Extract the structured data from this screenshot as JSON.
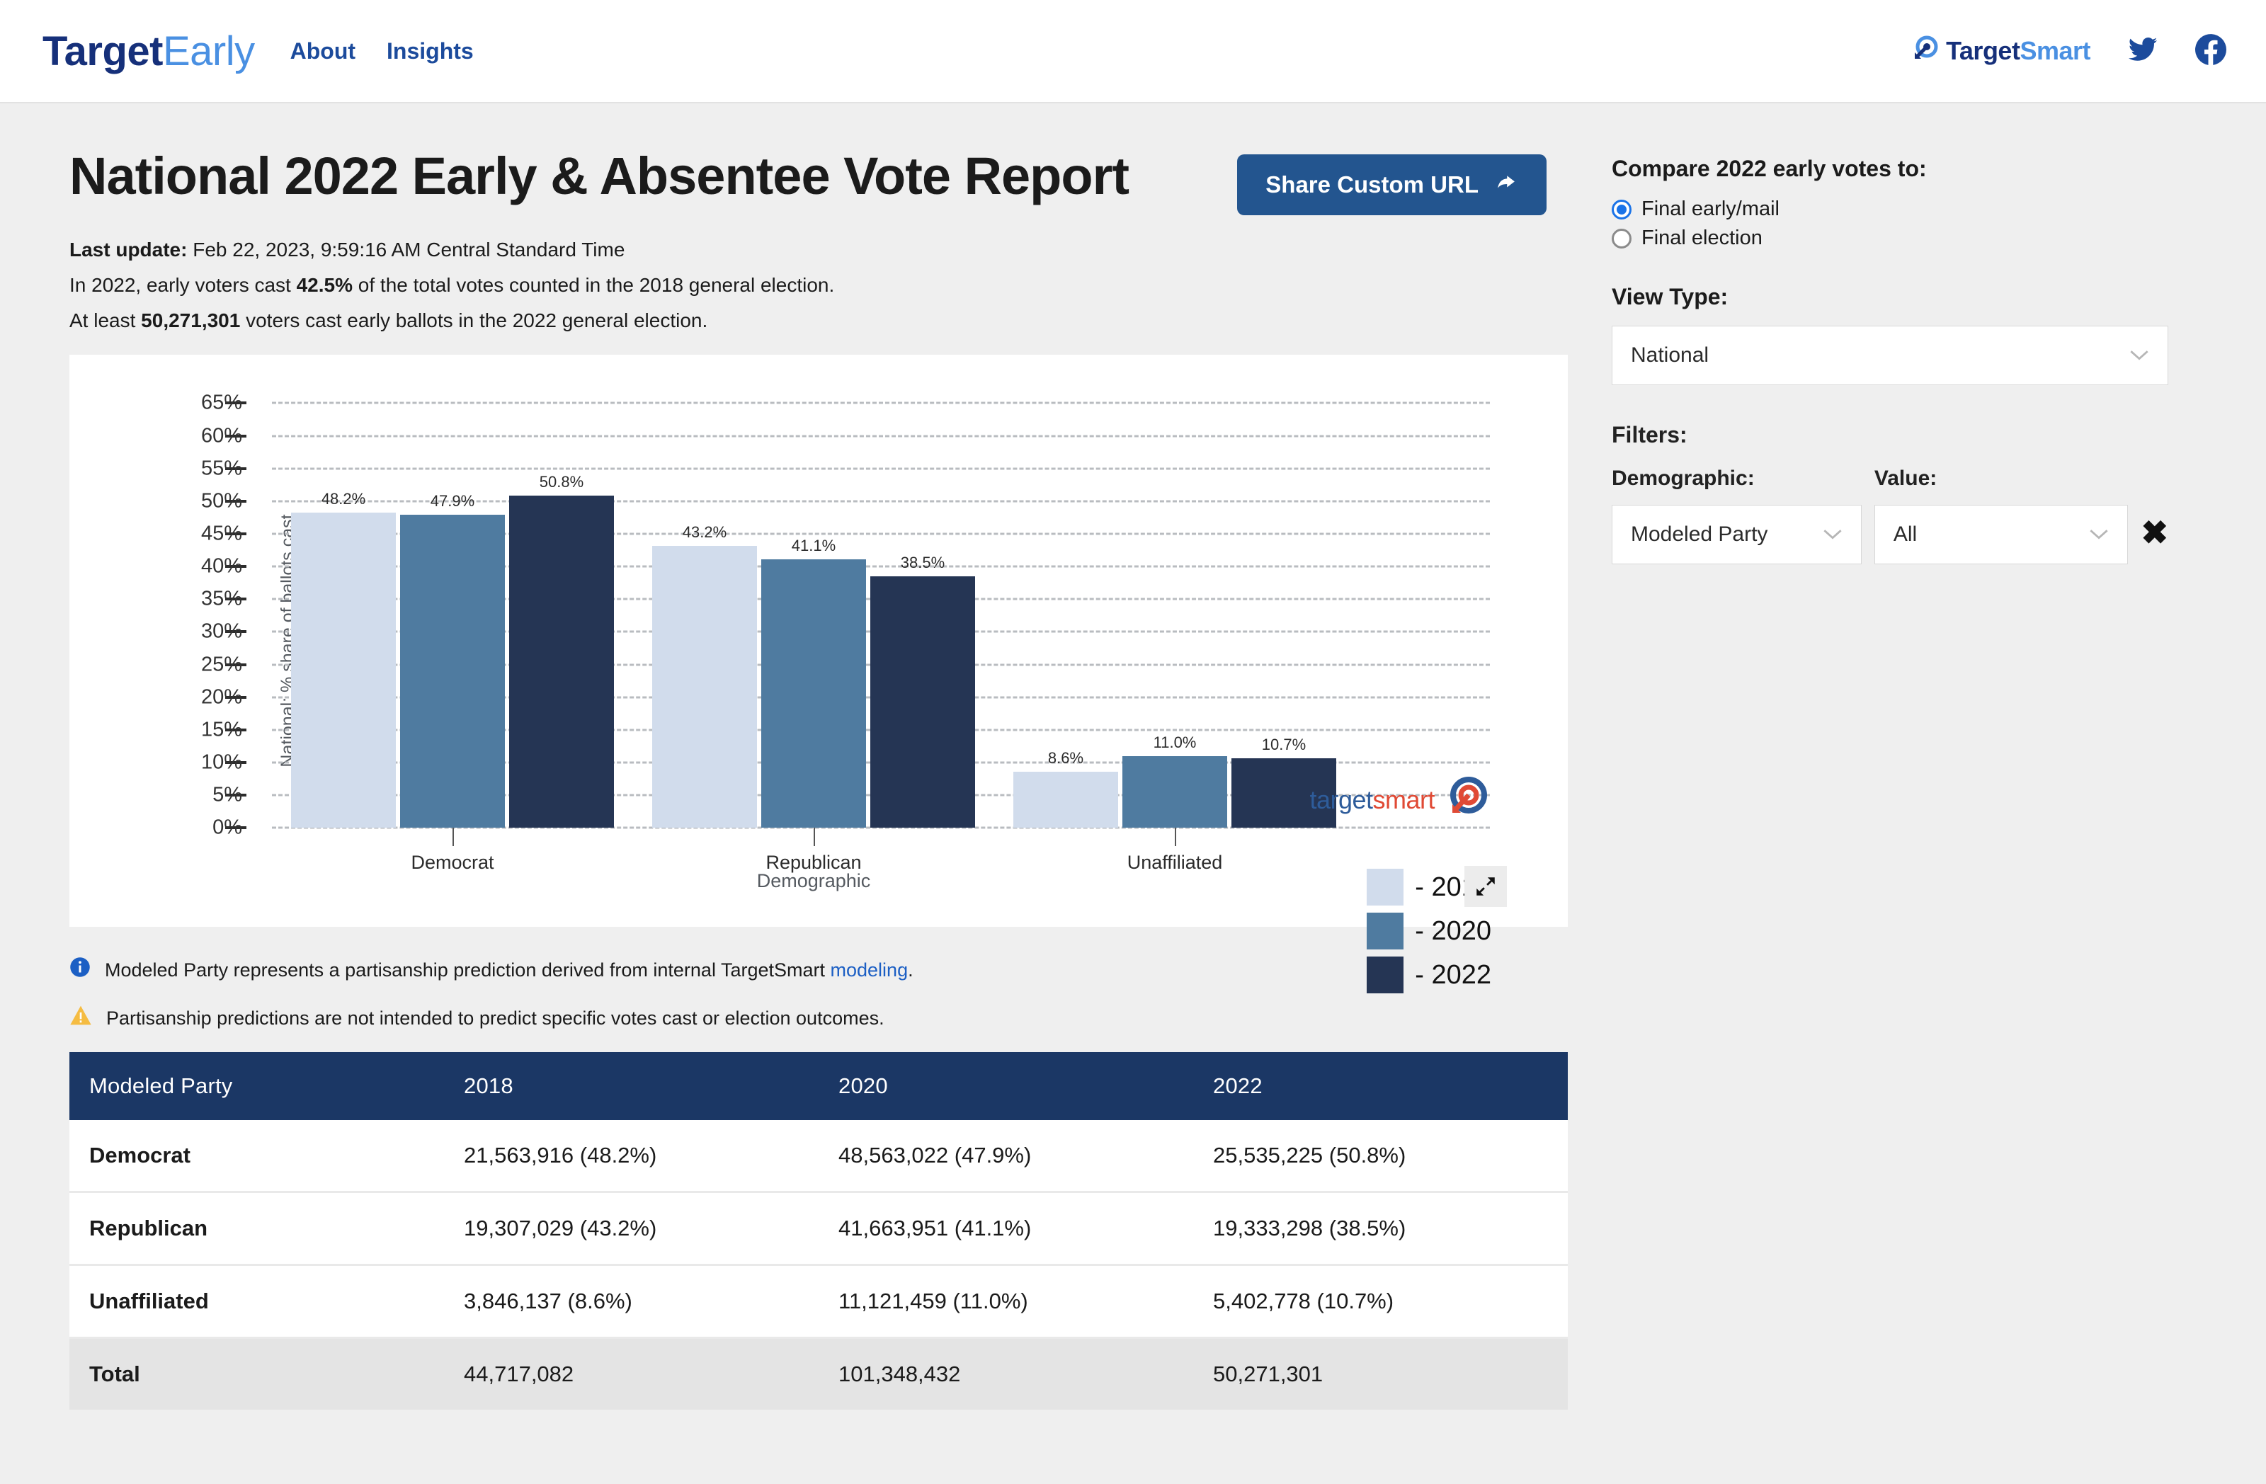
{
  "nav": {
    "brand_part1": "Target",
    "brand_part2": "Early",
    "links": [
      {
        "label": "About"
      },
      {
        "label": "Insights"
      }
    ],
    "org_logo_part1": "Target",
    "org_logo_part2": "Smart",
    "twitter_icon": "twitter-icon",
    "facebook_icon": "facebook-icon"
  },
  "header": {
    "title": "National 2022 Early & Absentee Vote Report",
    "share_button": "Share Custom URL",
    "last_update_label": "Last update:",
    "last_update_value": "Feb 22, 2023, 9:59:16 AM Central Standard Time",
    "line2_a": "In 2022, early voters cast ",
    "line2_b": "42.5%",
    "line2_c": " of the total votes counted in the 2018 general election.",
    "line3_a": "At least ",
    "line3_b": "50,271,301",
    "line3_c": " voters cast early ballots in the 2022 general election."
  },
  "chart_data": {
    "type": "bar",
    "title": "",
    "xlabel": "Demographic",
    "ylabel": "National: % share of ballots cast",
    "categories": [
      "Democrat",
      "Republican",
      "Unaffiliated"
    ],
    "series": [
      {
        "name": "2018",
        "color": "#d1dcec",
        "values": [
          48.2,
          43.2,
          8.6
        ],
        "labels": [
          "48.2%",
          "43.2%",
          "8.6%"
        ]
      },
      {
        "name": "2020",
        "color": "#4f7ba0",
        "values": [
          47.9,
          41.1,
          11.0
        ],
        "labels": [
          "47.9%",
          "41.1%",
          "11.0%"
        ]
      },
      {
        "name": "2022",
        "color": "#253554",
        "values": [
          50.8,
          38.5,
          10.7
        ],
        "labels": [
          "50.8%",
          "38.5%",
          "10.7%"
        ]
      }
    ],
    "ylim": [
      0,
      65
    ],
    "yticks": [
      "0%",
      "5%",
      "10%",
      "15%",
      "20%",
      "25%",
      "30%",
      "35%",
      "40%",
      "45%",
      "50%",
      "55%",
      "60%",
      "65%"
    ],
    "ytick_values": [
      0,
      5,
      10,
      15,
      20,
      25,
      30,
      35,
      40,
      45,
      50,
      55,
      60,
      65
    ],
    "grid": true,
    "legend_position": "right",
    "legend_prefix": "- ",
    "watermark_part1": "target",
    "watermark_part2": "smart",
    "expand_icon": "expand-icon"
  },
  "notes": [
    {
      "icon": "info-icon",
      "text_before": "Modeled Party represents a partisanship prediction derived from internal TargetSmart ",
      "link": "modeling",
      "text_after": "."
    },
    {
      "icon": "warning-icon",
      "text_before": "Partisanship predictions are not intended to predict specific votes cast or election outcomes.",
      "link": "",
      "text_after": ""
    }
  ],
  "table": {
    "headers": [
      "Modeled Party",
      "2018",
      "2020",
      "2022"
    ],
    "rows": [
      {
        "party": "Democrat",
        "y2018": "21,563,916 (48.2%)",
        "y2020": "48,563,022 (47.9%)",
        "y2022": "25,535,225 (50.8%)"
      },
      {
        "party": "Republican",
        "y2018": "19,307,029 (43.2%)",
        "y2020": "41,663,951 (41.1%)",
        "y2022": "19,333,298 (38.5%)"
      },
      {
        "party": "Unaffiliated",
        "y2018": "3,846,137 (8.6%)",
        "y2020": "11,121,459 (11.0%)",
        "y2022": "5,402,778 (10.7%)"
      }
    ],
    "total": {
      "party": "Total",
      "y2018": "44,717,082",
      "y2020": "101,348,432",
      "y2022": "50,271,301"
    }
  },
  "controls": {
    "compare_heading": "Compare 2022 early votes to:",
    "radios": [
      {
        "label": "Final early/mail",
        "selected": true
      },
      {
        "label": "Final election",
        "selected": false
      }
    ],
    "view_type_heading": "View Type:",
    "view_type_value": "National",
    "filters_heading": "Filters:",
    "demographic_label": "Demographic:",
    "demographic_value": "Modeled Party",
    "value_label": "Value:",
    "value_value": "All",
    "remove_filter_icon": "close-icon",
    "chevron_icon": "chevron-down-icon"
  },
  "colors": {
    "accent_blue": "#23558f",
    "brand_navy": "#16307a",
    "brand_light_blue": "#4a90e2",
    "table_header": "#1b3765",
    "radio_on": "#1a73e8"
  }
}
